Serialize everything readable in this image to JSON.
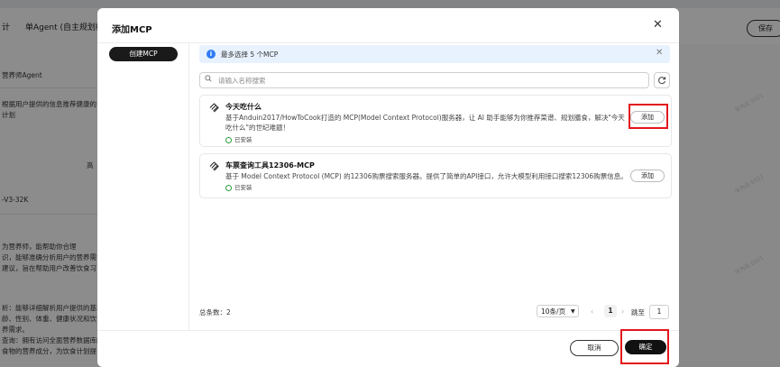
{
  "background": {
    "header_back": "计",
    "header_title": "单Agent (自主规划模式",
    "save_label": "保存",
    "side_lines": [
      "营养师Agent",
      "根据用户提供的信息推荐健康的",
      "计划",
      "高",
      "-V3-32K",
      "为营养师，能帮助你合理",
      "识，能够准确分析用户的营养需",
      "建议，旨在帮助用户改善饮食习",
      "析：能够详细解析用户提供的基本",
      "龄、性别、体重、健康状况和饮",
      "养需求。",
      "查询：拥有访问全面营养数据库的",
      "食物的营养成分，为饮食计划提"
    ],
    "watermark": "华为云 0321"
  },
  "modal": {
    "title": "添加MCP",
    "create_label": "创建MCP",
    "info_text": "最多选择 5 个MCP",
    "search_placeholder": "请输入名称搜索",
    "cards": [
      {
        "title": "今天吃什么",
        "desc": "基于Anduin2017/HowToCook打造的 MCP(Model Context Protocol)服务器，让 AI 助手能够为你推荐菜谱、规划膳食，解决\"今天吃什么\"的世纪难题！",
        "status": "已安装",
        "add_label": "添加"
      },
      {
        "title": "车票查询工具12306-MCP",
        "desc": "基于 Model Context Protocol (MCP) 的12306购票搜索服务器。提供了简单的API接口，允许大模型利用接口搜索12306购票信息。",
        "status": "已安装",
        "add_label": "添加"
      }
    ],
    "total_label": "总条数：2",
    "page_size": "10条/页",
    "current_page": "1",
    "jump_label": "跳至",
    "jump_value": "1",
    "cancel_label": "取消",
    "confirm_label": "确定",
    "colors": {
      "primary": "#111111",
      "info_bg": "#e8f2ff",
      "info_icon": "#2f7bf5",
      "highlight": "#e3161c",
      "installed": "#2a9d3c"
    }
  }
}
